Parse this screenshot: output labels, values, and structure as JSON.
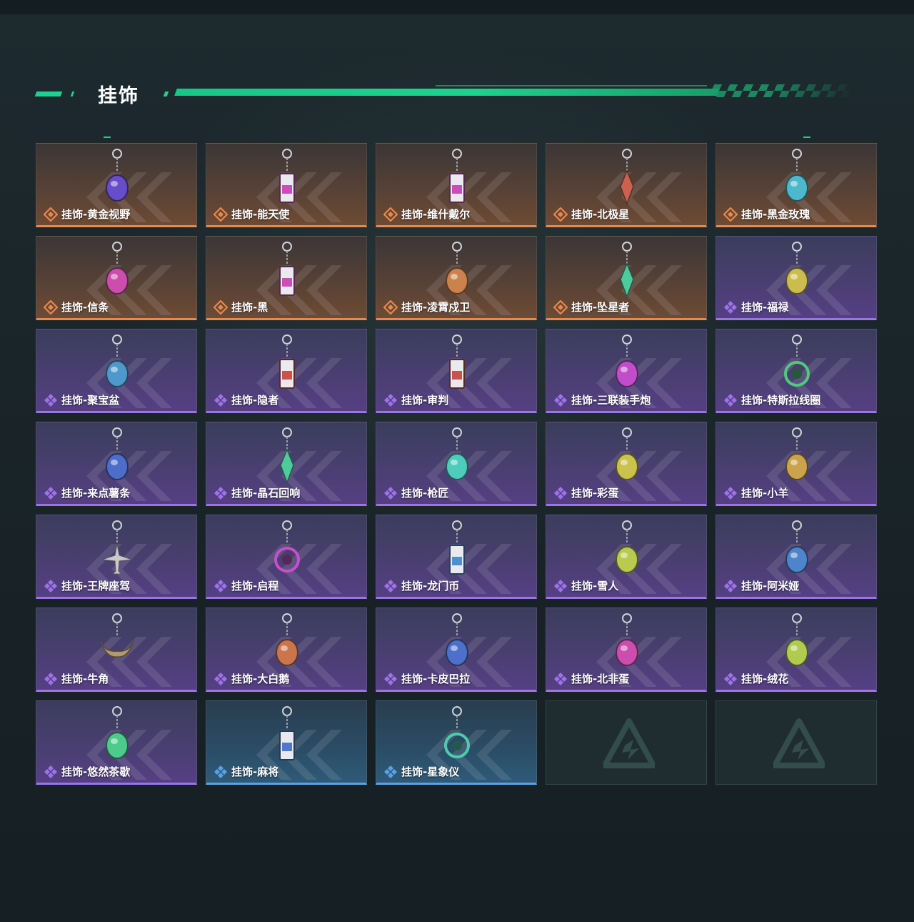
{
  "section": {
    "title": "挂饰"
  },
  "colors": {
    "accent": "#1fd18f",
    "orange": "#e9884a",
    "purple": "#9d73ea",
    "blue": "#5aa2e6",
    "empty_slot": "#1f2d31"
  },
  "items": [
    {
      "label": "挂饰-黄金视野",
      "rarity": "orange",
      "icon": "golden-doll-charm-icon"
    },
    {
      "label": "挂饰-能天使",
      "rarity": "orange",
      "icon": "card-charm-icon"
    },
    {
      "label": "挂饰-维什戴尔",
      "rarity": "orange",
      "icon": "card-charm-icon"
    },
    {
      "label": "挂饰-北极星",
      "rarity": "orange",
      "icon": "star-charm-icon"
    },
    {
      "label": "挂饰-黑金玫瑰",
      "rarity": "orange",
      "icon": "rose-charm-icon"
    },
    {
      "label": "挂饰-信条",
      "rarity": "orange",
      "icon": "bird-charm-icon"
    },
    {
      "label": "挂饰-黑",
      "rarity": "orange",
      "icon": "card-charm-icon"
    },
    {
      "label": "挂饰-凌霄戍卫",
      "rarity": "orange",
      "icon": "flame-charm-icon"
    },
    {
      "label": "挂饰-坠星者",
      "rarity": "orange",
      "icon": "crystal-charm-icon"
    },
    {
      "label": "挂饰-福禄",
      "rarity": "purple",
      "icon": "gourd-charm-icon"
    },
    {
      "label": "挂饰-聚宝盆",
      "rarity": "purple",
      "icon": "treasure-bowl-charm-icon"
    },
    {
      "label": "挂饰-隐者",
      "rarity": "purple",
      "icon": "tarot-charm-icon"
    },
    {
      "label": "挂饰-审判",
      "rarity": "purple",
      "icon": "tarot-charm-icon"
    },
    {
      "label": "挂饰-三联装手炮",
      "rarity": "purple",
      "icon": "cannon-charm-icon"
    },
    {
      "label": "挂饰-特斯拉线圈",
      "rarity": "purple",
      "icon": "coil-charm-icon"
    },
    {
      "label": "挂饰-来点薯条",
      "rarity": "purple",
      "icon": "fries-charm-icon"
    },
    {
      "label": "挂饰-晶石回响",
      "rarity": "purple",
      "icon": "crystal-charm-icon"
    },
    {
      "label": "挂饰-枪匠",
      "rarity": "purple",
      "icon": "gun-part-charm-icon"
    },
    {
      "label": "挂饰-彩蛋",
      "rarity": "purple",
      "icon": "egg-charm-icon"
    },
    {
      "label": "挂饰-小羊",
      "rarity": "purple",
      "icon": "sheep-charm-icon"
    },
    {
      "label": "挂饰-王牌座驾",
      "rarity": "purple",
      "icon": "plane-charm-icon"
    },
    {
      "label": "挂饰-启程",
      "rarity": "purple",
      "icon": "ring-charm-icon"
    },
    {
      "label": "挂饰-龙门币",
      "rarity": "purple",
      "icon": "coin-card-charm-icon"
    },
    {
      "label": "挂饰-雪人",
      "rarity": "purple",
      "icon": "snowman-charm-icon"
    },
    {
      "label": "挂饰-阿米娅",
      "rarity": "purple",
      "icon": "bunny-charm-icon"
    },
    {
      "label": "挂饰-牛角",
      "rarity": "purple",
      "icon": "horns-charm-icon"
    },
    {
      "label": "挂饰-大白鹅",
      "rarity": "purple",
      "icon": "goose-charm-icon"
    },
    {
      "label": "挂饰-卡皮巴拉",
      "rarity": "purple",
      "icon": "capybara-charm-icon"
    },
    {
      "label": "挂饰-北非蛋",
      "rarity": "purple",
      "icon": "egg-dish-charm-icon"
    },
    {
      "label": "挂饰-绒花",
      "rarity": "purple",
      "icon": "flower-charm-icon"
    },
    {
      "label": "挂饰-悠然茶歇",
      "rarity": "purple",
      "icon": "cupcake-charm-icon"
    },
    {
      "label": "挂饰-麻将",
      "rarity": "blue",
      "icon": "mahjong-charm-icon"
    },
    {
      "label": "挂饰-星象仪",
      "rarity": "blue",
      "icon": "astrolabe-charm-icon"
    },
    {
      "label": "",
      "rarity": "empty",
      "icon": "empty-slot-logo-icon"
    },
    {
      "label": "",
      "rarity": "empty",
      "icon": "empty-slot-logo-icon"
    }
  ]
}
